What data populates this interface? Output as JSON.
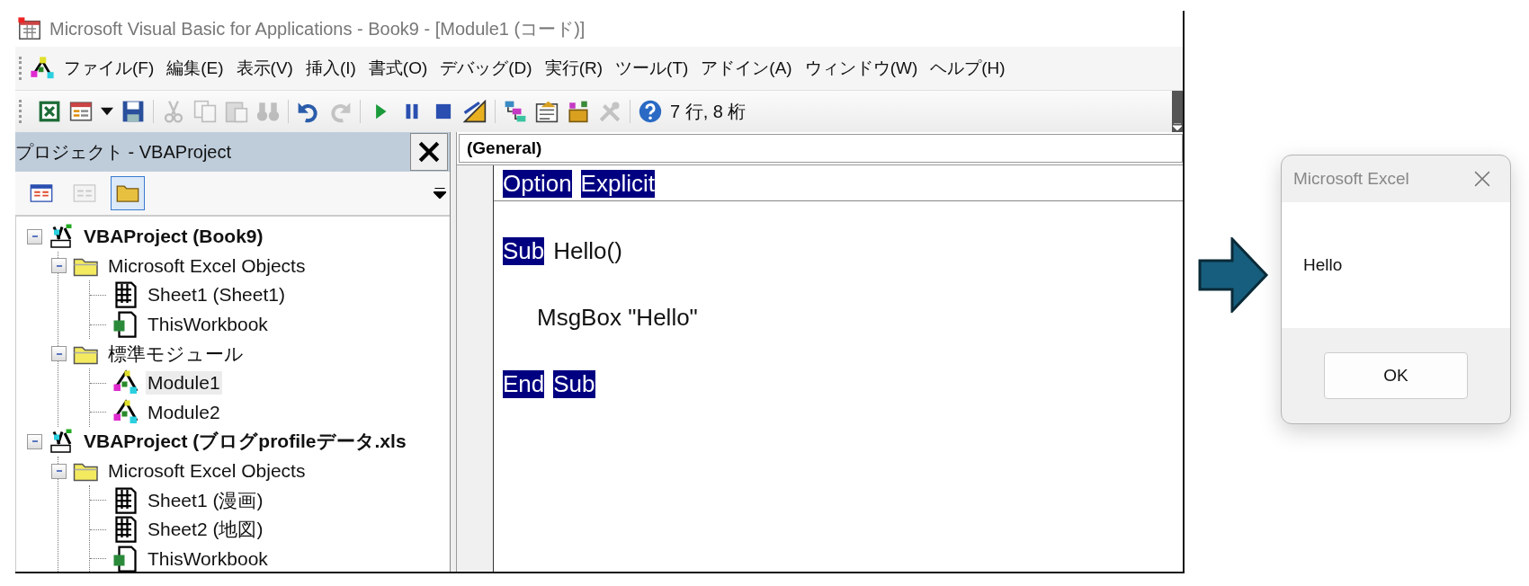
{
  "window": {
    "title": "Microsoft Visual Basic for Applications - Book9 - [Module1 (コード)]"
  },
  "menu": [
    "ファイル(F)",
    "編集(E)",
    "表示(V)",
    "挿入(I)",
    "書式(O)",
    "デバッグ(D)",
    "実行(R)",
    "ツール(T)",
    "アドイン(A)",
    "ウィンドウ(W)",
    "ヘルプ(H)"
  ],
  "toolbar": {
    "buttons": [
      {
        "kind": "excel",
        "disabled": false
      },
      {
        "kind": "userform",
        "disabled": false
      },
      {
        "kind": "dropdown",
        "disabled": false
      },
      {
        "kind": "save",
        "disabled": false
      },
      {
        "kind": "separator"
      },
      {
        "kind": "cut",
        "disabled": true
      },
      {
        "kind": "copy",
        "disabled": true
      },
      {
        "kind": "paste",
        "disabled": true
      },
      {
        "kind": "find",
        "disabled": true
      },
      {
        "kind": "separator"
      },
      {
        "kind": "undo",
        "disabled": false
      },
      {
        "kind": "redo",
        "disabled": true
      },
      {
        "kind": "separator"
      },
      {
        "kind": "run",
        "disabled": false
      },
      {
        "kind": "pause",
        "disabled": false
      },
      {
        "kind": "stop",
        "disabled": false
      },
      {
        "kind": "design",
        "disabled": false
      },
      {
        "kind": "separator"
      },
      {
        "kind": "explorer",
        "disabled": false
      },
      {
        "kind": "properties",
        "disabled": false
      },
      {
        "kind": "browser",
        "disabled": false
      },
      {
        "kind": "toolbox",
        "disabled": true
      },
      {
        "kind": "separator"
      },
      {
        "kind": "help",
        "disabled": false
      }
    ],
    "position": "7 行, 8 桁"
  },
  "project_pane": {
    "title": "プロジェクト - VBAProject",
    "buttons": [
      {
        "kind": "code",
        "selected": false,
        "disabled": false
      },
      {
        "kind": "object",
        "selected": false,
        "disabled": true
      },
      {
        "kind": "folders",
        "selected": true,
        "disabled": false
      }
    ],
    "tree": [
      {
        "label": "VBAProject (Book9)",
        "kind": "project",
        "expanded": true,
        "selected": false,
        "children": [
          {
            "label": "Microsoft Excel Objects",
            "kind": "folder",
            "expanded": true,
            "selected": false,
            "children": [
              {
                "label": "Sheet1 (Sheet1)",
                "kind": "sheet",
                "selected": false
              },
              {
                "label": "ThisWorkbook",
                "kind": "workbook",
                "selected": false
              }
            ]
          },
          {
            "label": "標準モジュール",
            "kind": "folder",
            "expanded": true,
            "selected": false,
            "children": [
              {
                "label": "Module1",
                "kind": "module",
                "selected": true
              },
              {
                "label": "Module2",
                "kind": "module",
                "selected": false
              }
            ]
          }
        ]
      },
      {
        "label": "VBAProject (ブログprofileデータ.xls",
        "kind": "project",
        "expanded": true,
        "selected": false,
        "children": [
          {
            "label": "Microsoft Excel Objects",
            "kind": "folder",
            "expanded": true,
            "selected": false,
            "children": [
              {
                "label": "Sheet1 (漫画)",
                "kind": "sheet",
                "selected": false
              },
              {
                "label": "Sheet2 (地図)",
                "kind": "sheet",
                "selected": false
              },
              {
                "label": "ThisWorkbook",
                "kind": "workbook",
                "selected": false
              }
            ]
          }
        ]
      }
    ]
  },
  "code_pane": {
    "object_box": "(General)",
    "lines": [
      {
        "kind": "code",
        "indented": false,
        "separator": true,
        "tokens": [
          {
            "text": "Option",
            "highlighted": true
          },
          {
            "text": "Explicit",
            "highlighted": true
          }
        ]
      },
      {
        "kind": "blank"
      },
      {
        "kind": "code",
        "indented": false,
        "separator": false,
        "tokens": [
          {
            "text": "Sub",
            "highlighted": true
          },
          {
            "text": "Hello()",
            "highlighted": false
          }
        ]
      },
      {
        "kind": "blank"
      },
      {
        "kind": "code",
        "indented": true,
        "separator": false,
        "tokens": [
          {
            "text": "MsgBox \"Hello\"",
            "highlighted": false
          }
        ]
      },
      {
        "kind": "blank"
      },
      {
        "kind": "code",
        "indented": false,
        "separator": false,
        "tokens": [
          {
            "text": "End",
            "highlighted": true
          },
          {
            "text": "Sub",
            "highlighted": true
          }
        ]
      }
    ]
  },
  "dialog": {
    "title": "Microsoft Excel",
    "message": "Hello",
    "button": "OK"
  }
}
